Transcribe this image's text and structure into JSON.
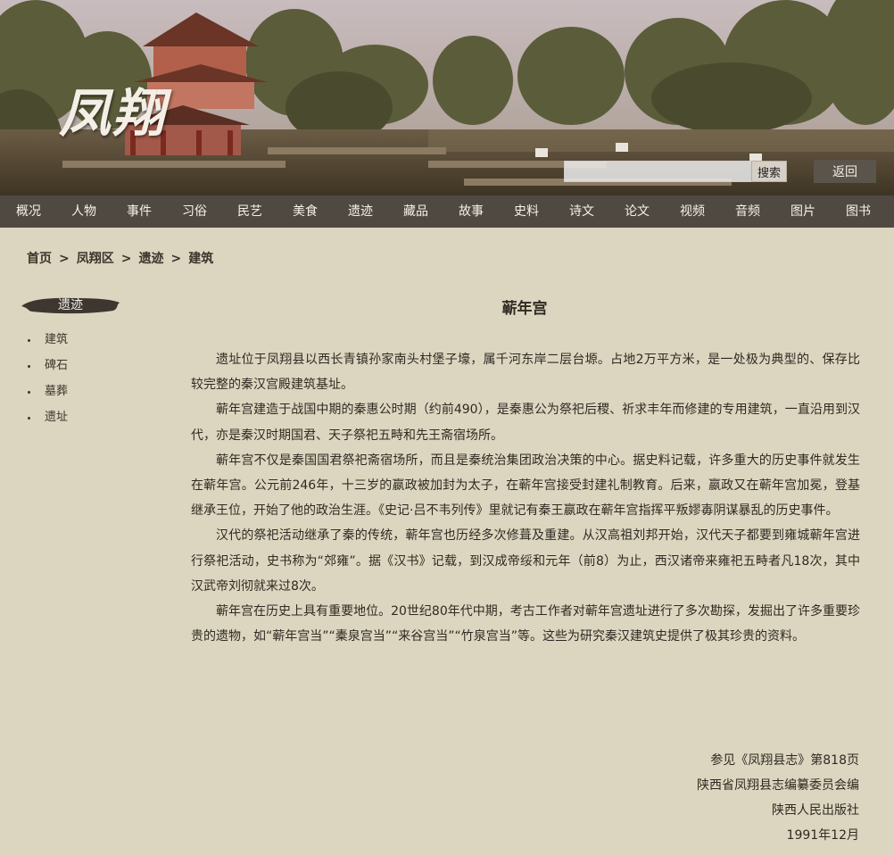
{
  "header": {
    "logo_text": "凤翔",
    "search_placeholder": "",
    "search_label": "搜索",
    "back_label": "返回"
  },
  "nav": {
    "items": [
      "概况",
      "人物",
      "事件",
      "习俗",
      "民艺",
      "美食",
      "遗迹",
      "藏品",
      "故事",
      "史料",
      "诗文",
      "论文",
      "视频",
      "音频",
      "图片",
      "图书"
    ]
  },
  "breadcrumb": {
    "items": [
      "首页",
      "凤翔区",
      "遗迹",
      "建筑"
    ],
    "separator": ">"
  },
  "sidebar": {
    "title": "遗迹",
    "items": [
      "建筑",
      "碑石",
      "墓葬",
      "遗址"
    ]
  },
  "article": {
    "title": "蕲年宫",
    "paragraphs": [
      "遗址位于凤翔县以西长青镇孙家南头村堡子壕，属千河东岸二层台塬。占地2万平方米，是一处极为典型的、保存比较完整的秦汉宫殿建筑基址。",
      "蕲年宫建造于战国中期的秦惠公时期（约前490），是秦惠公为祭祀后稷、祈求丰年而修建的专用建筑，一直沿用到汉代，亦是秦汉时期国君、天子祭祀五畤和先王斋宿场所。",
      "蕲年宫不仅是秦国国君祭祀斋宿场所，而且是秦统治集团政治决策的中心。据史料记载，许多重大的历史事件就发生在蕲年宫。公元前246年，十三岁的嬴政被加封为太子，在蕲年宫接受封建礼制教育。后来，嬴政又在蕲年宫加冕，登基继承王位，开始了他的政治生涯。《史记·吕不韦列传》里就记有秦王嬴政在蕲年宫指挥平叛嫪毐阴谋暴乱的历史事件。",
      "汉代的祭祀活动继承了秦的传统，蕲年宫也历经多次修葺及重建。从汉高祖刘邦开始，汉代天子都要到雍城蕲年宫进行祭祀活动，史书称为“郊雍”。据《汉书》记载，到汉成帝绥和元年（前8）为止，西汉诸帝来雍祀五畤者凡18次，其中汉武帝刘彻就来过8次。",
      "蕲年宫在历史上具有重要地位。20世纪80年代中期，考古工作者对蕲年宫遗址进行了多次勘探，发掘出了许多重要珍贵的遗物，如“蕲年宫当”“橐泉宫当”“来谷宫当”“竹泉宫当”等。这些为研究秦汉建筑史提供了极其珍贵的资料。"
    ]
  },
  "source": {
    "lines": [
      "参见《凤翔县志》第818页",
      "陕西省凤翔县志编纂委员会编",
      "陕西人民出版社",
      "1991年12月"
    ]
  },
  "colors": {
    "page_bg": "#dcd6c0",
    "nav_bg": "#4f4942",
    "nav_text": "#f5f1ea",
    "text": "#2f2a22"
  }
}
